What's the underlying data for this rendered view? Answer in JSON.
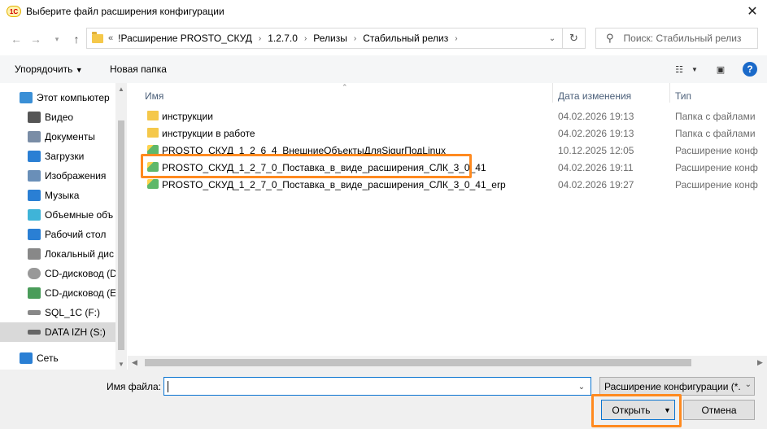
{
  "window": {
    "app_icon_text": "1C",
    "title": "Выберите файл расширения конфигурации",
    "close_glyph": "✕"
  },
  "address_bar": {
    "overflow": "«",
    "crumbs": [
      "!Расширение PROSTO_СКУД",
      "1.2.7.0",
      "Релизы",
      "Стабильный релиз"
    ],
    "search_placeholder": "Поиск: Стабильный релиз"
  },
  "toolbar": {
    "organize": "Упорядочить",
    "new_folder": "Новая папка",
    "help": "?"
  },
  "nav": {
    "items": [
      {
        "label": "Этот компьютер",
        "icon": "computer-icon",
        "color": "#3a8fd6"
      },
      {
        "label": "Видео",
        "icon": "video-icon",
        "color": "#555555"
      },
      {
        "label": "Документы",
        "icon": "documents-icon",
        "color": "#7a8da6"
      },
      {
        "label": "Загрузки",
        "icon": "downloads-icon",
        "color": "#2a7fd4"
      },
      {
        "label": "Изображения",
        "icon": "pictures-icon",
        "color": "#6a8fb8"
      },
      {
        "label": "Музыка",
        "icon": "music-icon",
        "color": "#2a7fd4"
      },
      {
        "label": "Объемные объ",
        "icon": "3d-objects-icon",
        "color": "#3fb4d8"
      },
      {
        "label": "Рабочий стол",
        "icon": "desktop-icon",
        "color": "#2a7fd4"
      },
      {
        "label": "Локальный дис",
        "icon": "local-disk-icon",
        "color": "#888888"
      },
      {
        "label": "CD-дисковод (D",
        "icon": "cd-drive-icon",
        "color": "#999999"
      },
      {
        "label": "CD-дисковод (E",
        "icon": "cd-drive-icon",
        "color": "#4a9c5a"
      },
      {
        "label": "SQL_1C (F:)",
        "icon": "drive-icon",
        "color": "#888888"
      },
      {
        "label": "DATA IZH (S:)",
        "icon": "drive-icon",
        "color": "#888888"
      },
      {
        "label": "Сеть",
        "icon": "network-icon",
        "color": "#2a7fd4"
      }
    ]
  },
  "filelist": {
    "columns": {
      "name": "Имя",
      "date": "Дата изменения",
      "type": "Тип"
    },
    "rows": [
      {
        "name": "инструкции",
        "date": "04.02.2026 19:13",
        "type": "Папка с файлами",
        "kind": "folder"
      },
      {
        "name": "инструкции в работе",
        "date": "04.02.2026 19:13",
        "type": "Папка с файлами",
        "kind": "folder"
      },
      {
        "name": "PROSTO_СКУД_1_2_6_4_ВнешниеОбъектыДляSigurПодLinux",
        "date": "10.12.2025 12:05",
        "type": "Расширение конф",
        "kind": "extension"
      },
      {
        "name": "PROSTO_СКУД_1_2_7_0_Поставка_в_виде_расширения_СЛК_3_0_41",
        "date": "04.02.2026 19:11",
        "type": "Расширение конф",
        "kind": "extension"
      },
      {
        "name": "PROSTO_СКУД_1_2_7_0_Поставка_в_виде_расширения_СЛК_3_0_41_erp",
        "date": "04.02.2026 19:27",
        "type": "Расширение конф",
        "kind": "extension"
      }
    ]
  },
  "bottom": {
    "filename_label": "Имя файла:",
    "filename_value": "",
    "filter": "Расширение конфигурации (*.",
    "open": "Открыть",
    "cancel": "Отмена"
  },
  "colors": {
    "highlight": "#ff8a1f",
    "accent": "#0a74d0"
  }
}
